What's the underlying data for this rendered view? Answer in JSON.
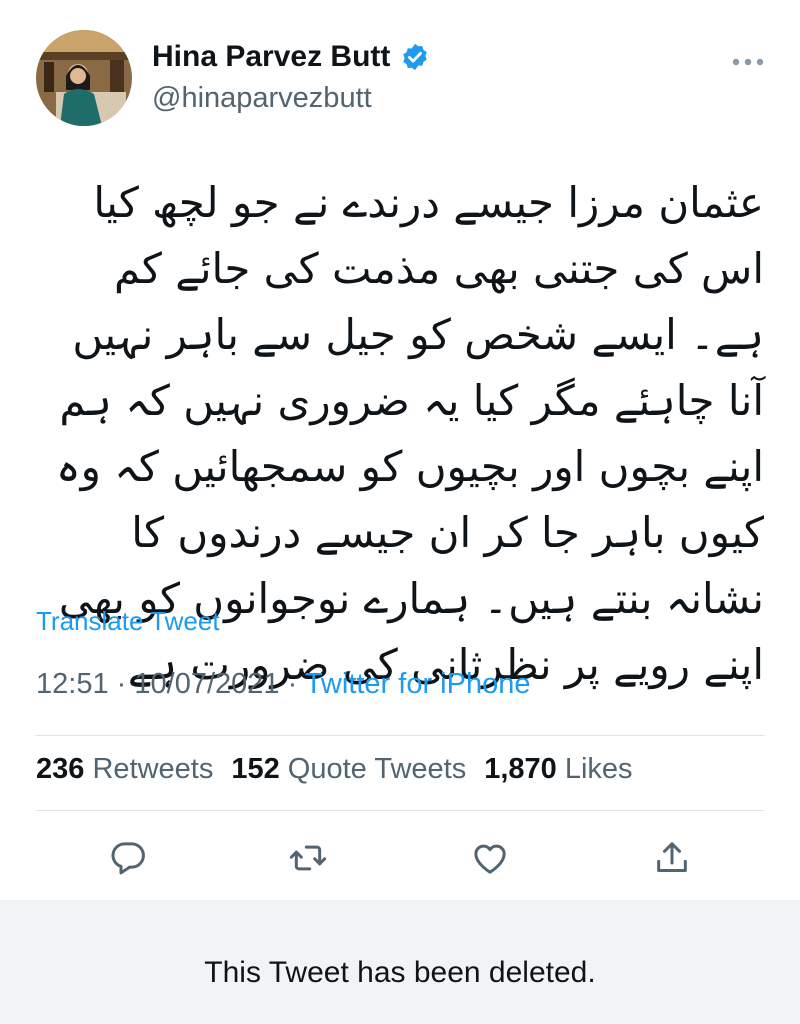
{
  "author": {
    "name": "Hina Parvez Butt",
    "handle": "@hinaparvezbutt",
    "verified": true,
    "avatar_icon": "profile-photo"
  },
  "tweet": {
    "text": "عثمان مرزا جیسے درندے نے جو لچھ کیا اس کی جتنی بھی مذمت کی جائے کم ہے۔ ایسے شخص کو جیل سے باہر نہیں آنا چاہئے مگر کیا یہ ضروری نہیں کہ ہم اپنے بچوں اور بچیوں کو سمجھائیں کہ وہ کیوں باہر جا کر ان جیسے درندوں کا نشانہ بنتے ہیں۔ ہمارے نوجوانوں کو بھی اپنے رویے پر نظرثانی کی ضرورت ہے",
    "translate_label": "Translate Tweet",
    "time": "12:51",
    "date": "10/07/2021",
    "separator": "·",
    "source": "Twitter for iPhone"
  },
  "stats": {
    "retweets_count": "236",
    "retweets_label": "Retweets",
    "quotes_count": "152",
    "quotes_label": "Quote Tweets",
    "likes_count": "1,870",
    "likes_label": "Likes"
  },
  "actions": {
    "icons": [
      "reply-icon",
      "retweet-icon",
      "like-icon",
      "share-icon"
    ]
  },
  "notice": {
    "deleted_text": "This Tweet has been deleted."
  },
  "colors": {
    "accent": "#1d9bf0",
    "secondary_text": "#536471",
    "primary_text": "#0f1419",
    "deleted_band": "#f2f3f5"
  }
}
